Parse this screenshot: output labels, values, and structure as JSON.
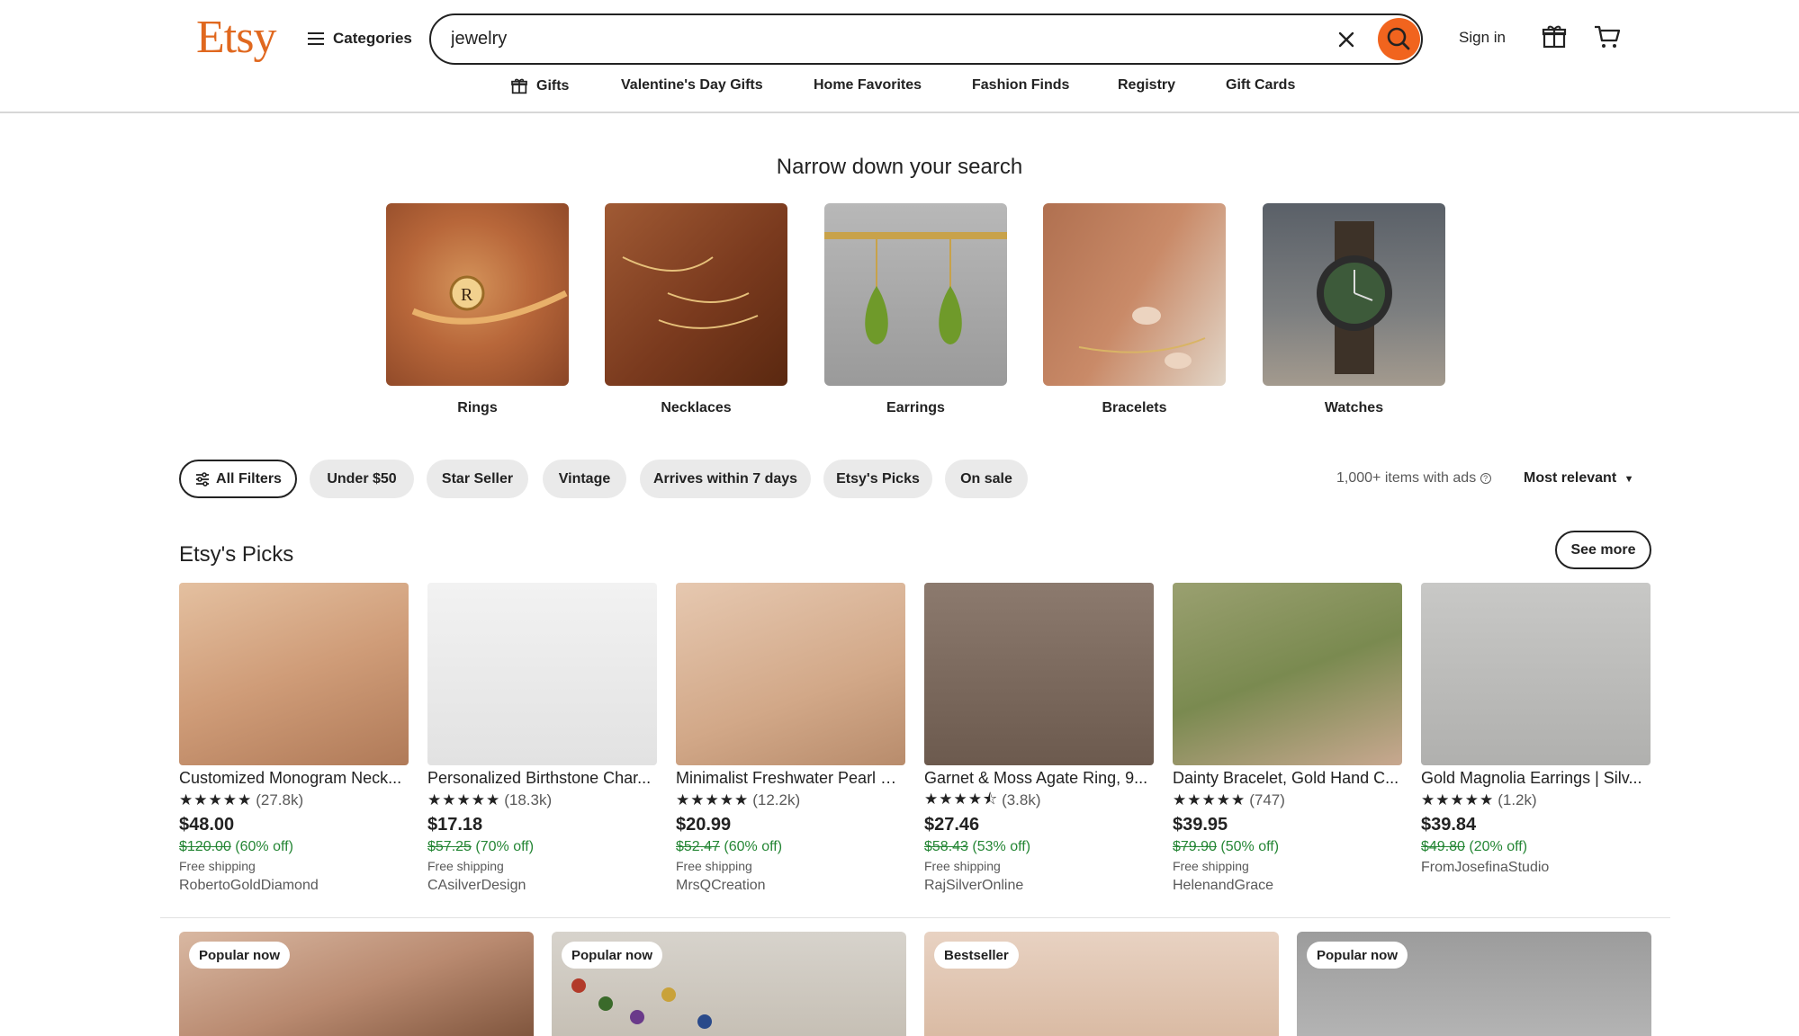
{
  "header": {
    "logo": "Etsy",
    "categories_label": "Categories",
    "search_value": "jewelry",
    "signin_label": "Sign in"
  },
  "subnav": [
    "Gifts",
    "Valentine's Day Gifts",
    "Home Favorites",
    "Fashion Finds",
    "Registry",
    "Gift Cards"
  ],
  "narrow": {
    "title": "Narrow down your search",
    "categories": [
      "Rings",
      "Necklaces",
      "Earrings",
      "Bracelets",
      "Watches"
    ]
  },
  "filters": {
    "all_filters": "All Filters",
    "pills": [
      "Under $50",
      "Star Seller",
      "Vintage",
      "Arrives within 7 days",
      "Etsy's Picks",
      "On sale"
    ],
    "items_count": "1,000+ items with ads",
    "sort": "Most relevant"
  },
  "picks": {
    "title": "Etsy's Picks",
    "see_more": "See more",
    "products": [
      {
        "title": "Customized Monogram Neck...",
        "stars": 5,
        "reviews": "(27.8k)",
        "price": "$48.00",
        "original": "$120.00",
        "discount": "(60% off)",
        "shipping": "Free shipping",
        "shop": "RobertoGoldDiamond"
      },
      {
        "title": "Personalized Birthstone Char...",
        "stars": 5,
        "reviews": "(18.3k)",
        "price": "$17.18",
        "original": "$57.25",
        "discount": "(70% off)",
        "shipping": "Free shipping",
        "shop": "CAsilverDesign"
      },
      {
        "title": "Minimalist Freshwater Pearl N...",
        "stars": 5,
        "reviews": "(12.2k)",
        "price": "$20.99",
        "original": "$52.47",
        "discount": "(60% off)",
        "shipping": "Free shipping",
        "shop": "MrsQCreation"
      },
      {
        "title": "Garnet & Moss Agate Ring, 9...",
        "stars": 4.5,
        "reviews": "(3.8k)",
        "price": "$27.46",
        "original": "$58.43",
        "discount": "(53% off)",
        "shipping": "Free shipping",
        "shop": "RajSilverOnline"
      },
      {
        "title": "Dainty Bracelet, Gold Hand C...",
        "stars": 5,
        "reviews": "(747)",
        "price": "$39.95",
        "original": "$79.90",
        "discount": "(50% off)",
        "shipping": "Free shipping",
        "shop": "HelenandGrace"
      },
      {
        "title": "Gold Magnolia Earrings | Silv...",
        "stars": 5,
        "reviews": "(1.2k)",
        "price": "$39.84",
        "original": "$49.80",
        "discount": "(20% off)",
        "shipping": "",
        "shop": "FromJosefinaStudio"
      }
    ]
  },
  "bottom_badges": [
    "Popular now",
    "Popular now",
    "Bestseller",
    "Popular now"
  ],
  "colors": {
    "brand": "#f1641e",
    "logo": "#e0681f",
    "discount": "#258635",
    "pill_bg": "#eaeaea"
  },
  "icons": [
    "hamburger-icon",
    "close-icon",
    "search-icon",
    "gift-icon",
    "cart-icon",
    "sliders-icon",
    "info-icon",
    "caret-down-icon",
    "star-icon"
  ]
}
